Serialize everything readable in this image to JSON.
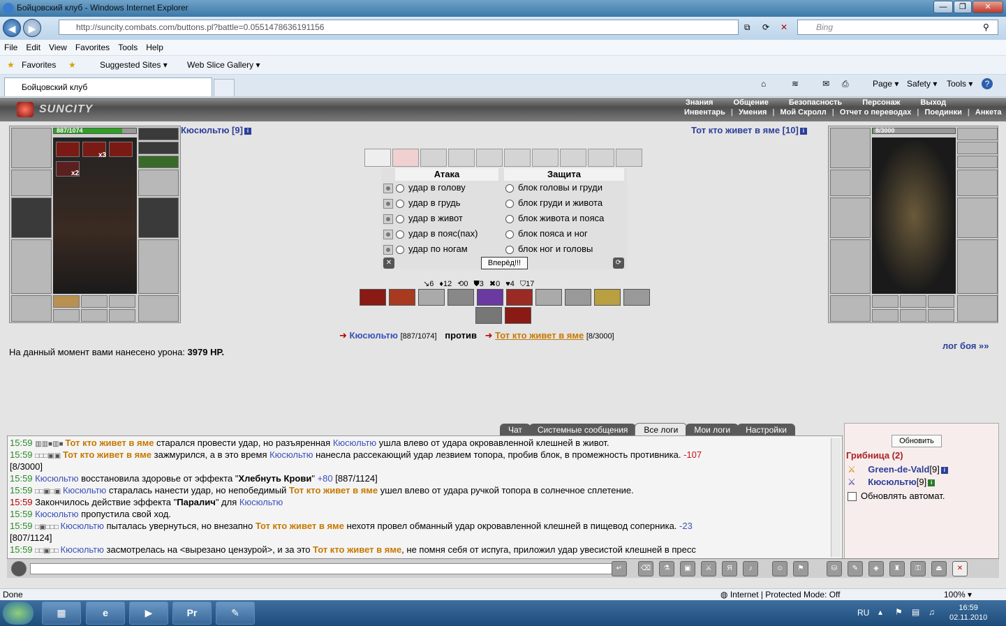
{
  "window": {
    "title": "Бойцовский клуб - Windows Internet Explorer",
    "min": "—",
    "max": "❐",
    "close": "✕"
  },
  "address": {
    "url": "http://suncity.combats.com/buttons.pl?battle=0.0551478636191156",
    "search_placeholder": "Bing"
  },
  "menu": [
    "File",
    "Edit",
    "View",
    "Favorites",
    "Tools",
    "Help"
  ],
  "favorites": {
    "favorites": "Favorites",
    "suggested": "Suggested Sites ▾",
    "webslice": "Web Slice Gallery ▾"
  },
  "tab": {
    "label": "Бойцовский клуб"
  },
  "commandbar": {
    "page": "Page ▾",
    "safety": "Safety ▾",
    "tools": "Tools ▾",
    "help": "?"
  },
  "game": {
    "logo": "SUNCITY",
    "topmenu1": [
      "Знания",
      "Общение",
      "Безопасность",
      "Персонаж",
      "Выход"
    ],
    "topmenu2": [
      "Инвентарь",
      "Умения",
      "Мой Скролл",
      "Отчет о переводах",
      "Поединки",
      "Анкета"
    ],
    "player": {
      "name": "Кюсюльтю [9]",
      "hp": "887/1074",
      "hp_fraction": 0.83,
      "x3": "x3",
      "x2": "x2"
    },
    "enemy": {
      "name": "Тот кто живет в яме [10]",
      "hp": "8/3000",
      "hp_fraction": 0.003
    },
    "attack_header": "Атака",
    "defense_header": "Защита",
    "attacks": [
      "удар в голову",
      "удар в грудь",
      "удар в живот",
      "удар в пояс(пах)",
      "удар по ногам"
    ],
    "defenses": [
      "блок головы и груди",
      "блок груди и живота",
      "блок живота и пояса",
      "блок пояса и ног",
      "блок ног и головы"
    ],
    "forward": "Вперёд!!!",
    "stats": [
      "↘6",
      "♦12",
      "⟲0",
      "⛊3",
      "✖0",
      "♥4",
      "⛉17"
    ],
    "versus": {
      "me": "Кюсюльтю",
      "me_hp": "[887/1074]",
      "vs": "против",
      "enemy": "Тот кто живет в яме",
      "enemy_hp": "[8/3000]"
    },
    "damage_prefix": "На данный момент вами нанесено урона:",
    "damage_value": "3979 HP.",
    "battle_log_link": "лог боя »»",
    "log_tabs": [
      "Чат",
      "Системные сообщения",
      "Все логи",
      "Мои логи",
      "Настройки"
    ],
    "log": [
      {
        "time": "15:59",
        "marks": "▥▥■▥■",
        "parts": [
          [
            "en",
            "Тот кто живет в яме"
          ],
          [
            "t",
            " старался провести удар, но разъяренная "
          ],
          [
            "me",
            "Кюсюльтю"
          ],
          [
            "t",
            " ушла влево от удара окровавленной клешней в живот."
          ]
        ]
      },
      {
        "time": "15:59",
        "marks": "□□□▣▣",
        "parts": [
          [
            "en",
            "Тот кто живет в яме"
          ],
          [
            "t",
            " зажмурился, а в это время "
          ],
          [
            "me",
            "Кюсюльтю"
          ],
          [
            "t",
            " нанесла рассекающий удар лезвием топора, пробив блок, в промежность противника. "
          ],
          [
            "neg",
            "-107"
          ]
        ]
      },
      {
        "time": "",
        "marks": "",
        "parts": [
          [
            "t",
            "[8/3000]"
          ]
        ]
      },
      {
        "time": "15:59",
        "marks": "",
        "parts": [
          [
            "me",
            "Кюсюльтю"
          ],
          [
            "t",
            " восстановила здоровье от эффекта \""
          ],
          [
            "b",
            "Хлебнуть Крови"
          ],
          [
            "t",
            "\" "
          ],
          [
            "pos",
            "+80"
          ],
          [
            "t",
            " [887/1124]"
          ]
        ]
      },
      {
        "time": "15:59",
        "marks": "□□▣□▣",
        "parts": [
          [
            "me",
            "Кюсюльтю"
          ],
          [
            "t",
            " старалась нанести удар, но непобедимый "
          ],
          [
            "en",
            "Тот кто живет в яме"
          ],
          [
            "t",
            " ушел влево от удара ручкой топора в солнечное сплетение."
          ]
        ]
      },
      {
        "time": "15:59",
        "red": true,
        "marks": "",
        "parts": [
          [
            "t",
            "Закончилось действие эффекта \""
          ],
          [
            "b",
            "Паралич"
          ],
          [
            "t",
            "\" для "
          ],
          [
            "me",
            "Кюсюльтю"
          ]
        ]
      },
      {
        "time": "15:59",
        "marks": "",
        "parts": [
          [
            "me",
            "Кюсюльтю"
          ],
          [
            "t",
            " пропустила свой ход."
          ]
        ]
      },
      {
        "time": "15:59",
        "marks": "□▣□□□",
        "parts": [
          [
            "me",
            "Кюсюльтю"
          ],
          [
            "t",
            " пыталась увернуться, но внезапно "
          ],
          [
            "en",
            "Тот кто живет в яме"
          ],
          [
            "t",
            " нехотя провел обманный удар окровавленной клешней в пищевод соперника. "
          ],
          [
            "pos",
            "-23"
          ]
        ]
      },
      {
        "time": "",
        "marks": "",
        "parts": [
          [
            "t",
            "[807/1124]"
          ]
        ]
      },
      {
        "time": "15:59",
        "marks": "□□▣□□",
        "parts": [
          [
            "me",
            "Кюсюльтю"
          ],
          [
            "t",
            " засмотрелась на <вырезано цензурой>, и за это "
          ],
          [
            "en",
            "Тот кто живет в яме"
          ],
          [
            "t",
            ", не помня себя от испуга, приложил удар увесистой клешней в пресс"
          ]
        ]
      }
    ],
    "sidepanel": {
      "refresh": "Обновить",
      "group": "Грибница (2)",
      "users": [
        {
          "name": "Green-de-Vald",
          "lvl": "[9]"
        },
        {
          "name": "Кюсюльтю",
          "lvl": "[9]"
        }
      ],
      "auto": "Обновлять автомат."
    }
  },
  "status": {
    "left": "Done",
    "zone": "Internet | Protected Mode: Off",
    "zoom": "100% ▾"
  },
  "taskbar": {
    "lang": "RU",
    "time": "16:59",
    "date": "02.11.2010"
  }
}
